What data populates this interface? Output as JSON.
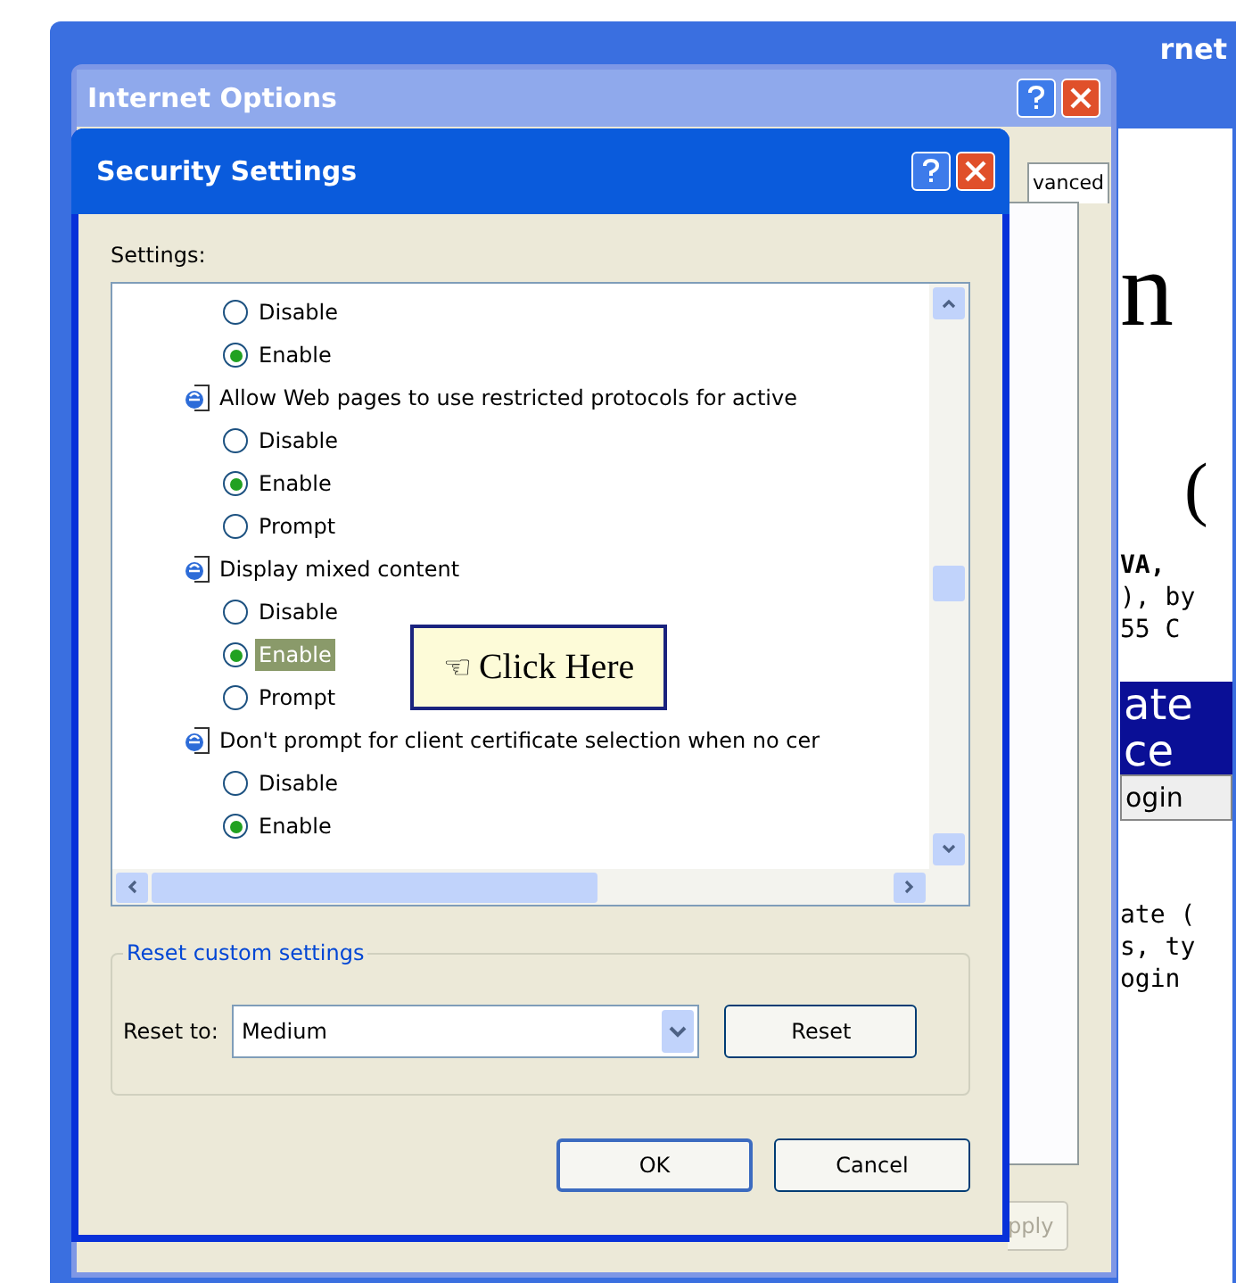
{
  "browser": {
    "title_fragment": "rnet",
    "page_fragments": [
      {
        "kind": "big",
        "text": "n"
      },
      {
        "kind": "paren",
        "text": "("
      },
      {
        "kind": "bold",
        "text": "VA,"
      },
      {
        "kind": "plain",
        "text": "), by"
      },
      {
        "kind": "plain",
        "text": "55 C"
      },
      {
        "kind": "band",
        "text": "ate"
      },
      {
        "kind": "band",
        "text": "ce"
      },
      {
        "kind": "button",
        "text": "ogin"
      },
      {
        "kind": "mono",
        "text": "ate ("
      },
      {
        "kind": "mono",
        "text": "s, ty"
      },
      {
        "kind": "mono",
        "text": "ogin"
      }
    ]
  },
  "internet_options": {
    "title": "Internet Options",
    "tab_fragment": "vanced",
    "apply_button": {
      "label": "pply",
      "disabled": true
    }
  },
  "security_settings": {
    "title": "Security Settings",
    "settings_label": "Settings:",
    "items": [
      {
        "kind": "option",
        "label": "Disable",
        "selected": false,
        "highlighted": false
      },
      {
        "kind": "option",
        "label": "Enable",
        "selected": true,
        "highlighted": false
      },
      {
        "kind": "heading",
        "label": "Allow Web pages to use restricted protocols for active"
      },
      {
        "kind": "option",
        "label": "Disable",
        "selected": false,
        "highlighted": false
      },
      {
        "kind": "option",
        "label": "Enable",
        "selected": true,
        "highlighted": false
      },
      {
        "kind": "option",
        "label": "Prompt",
        "selected": false,
        "highlighted": false
      },
      {
        "kind": "heading",
        "label": "Display mixed content"
      },
      {
        "kind": "option",
        "label": "Disable",
        "selected": false,
        "highlighted": false
      },
      {
        "kind": "option",
        "label": "Enable",
        "selected": true,
        "highlighted": true
      },
      {
        "kind": "option",
        "label": "Prompt",
        "selected": false,
        "highlighted": false
      },
      {
        "kind": "heading",
        "label": "Don't prompt for client certificate selection when no cer"
      },
      {
        "kind": "option",
        "label": "Disable",
        "selected": false,
        "highlighted": false
      },
      {
        "kind": "option",
        "label": "Enable",
        "selected": true,
        "highlighted": false
      }
    ],
    "reset_group": {
      "legend": "Reset custom settings",
      "label": "Reset to:",
      "value": "Medium",
      "button": "Reset"
    },
    "buttons": [
      "OK",
      "Cancel"
    ]
  },
  "callout": {
    "icon": "☜",
    "text": "Click Here"
  }
}
